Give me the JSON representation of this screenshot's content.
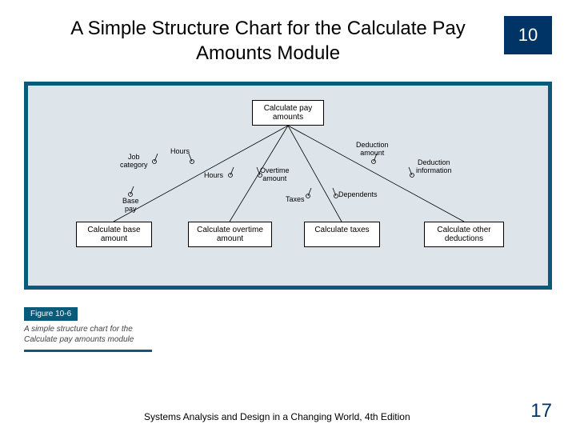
{
  "chapter_number": "10",
  "title": "A Simple Structure Chart for the Calculate Pay Amounts Module",
  "chart_data": {
    "type": "structure-chart",
    "root": {
      "label": "Calculate pay amounts"
    },
    "children": [
      {
        "label": "Calculate base amount",
        "inputs": [
          "Job category",
          "Hours"
        ],
        "outputs": [
          "Base pay"
        ]
      },
      {
        "label": "Calculate overtime amount",
        "inputs": [
          "Hours"
        ],
        "outputs": [
          "Overtime amount"
        ]
      },
      {
        "label": "Calculate taxes",
        "inputs": [
          "Dependents"
        ],
        "outputs": [
          "Taxes"
        ]
      },
      {
        "label": "Calculate other deductions",
        "inputs": [
          "Deduction information"
        ],
        "outputs": [
          "Deduction amount"
        ]
      }
    ]
  },
  "labels": {
    "job_category": "Job\ncategory",
    "hours1": "Hours",
    "base_pay": "Base\npay",
    "hours2": "Hours",
    "overtime_amount": "Overtime\namount",
    "taxes": "Taxes",
    "dependents": "Dependents",
    "deduction_amount": "Deduction\namount",
    "deduction_information": "Deduction\ninformation"
  },
  "figure": {
    "tag": "Figure 10-6",
    "caption": "A simple structure chart for the Calculate pay amounts module"
  },
  "footer": "Systems Analysis and Design in a Changing World, 4th Edition",
  "page_number": "17"
}
